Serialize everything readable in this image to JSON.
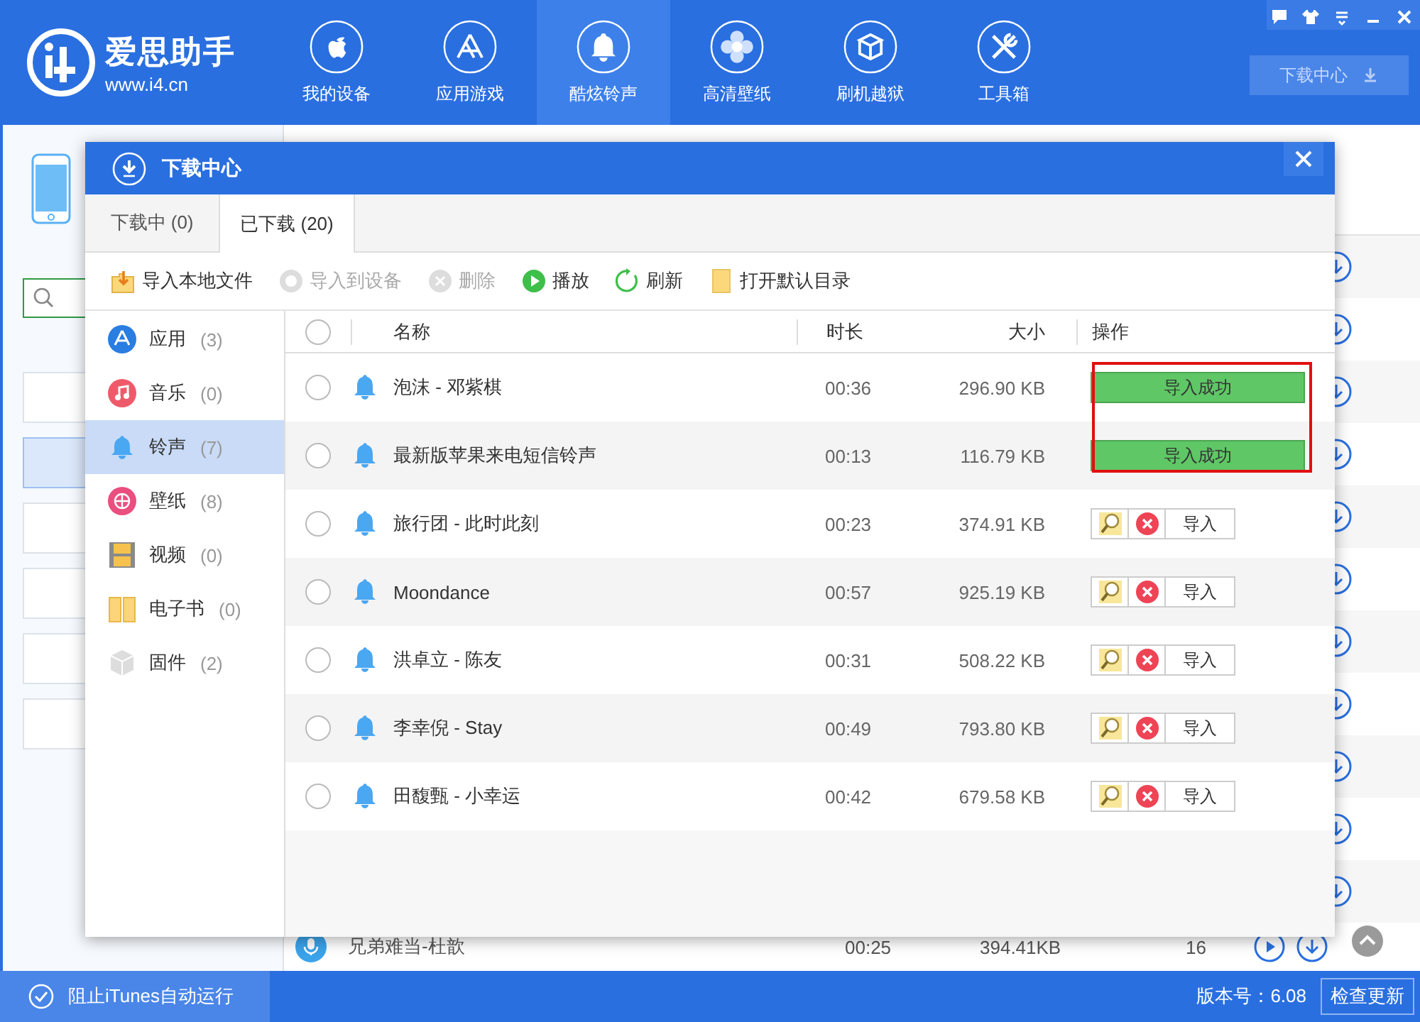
{
  "app": {
    "logo_name": "爱思助手",
    "logo_url": "www.i4.cn"
  },
  "nav": [
    {
      "label": "我的设备",
      "kind": "apple",
      "selected": false
    },
    {
      "label": "应用游戏",
      "kind": "appstore",
      "selected": false
    },
    {
      "label": "酷炫铃声",
      "kind": "bell",
      "selected": true
    },
    {
      "label": "高清壁纸",
      "kind": "flower",
      "selected": false
    },
    {
      "label": "刷机越狱",
      "kind": "box",
      "selected": false
    },
    {
      "label": "工具箱",
      "kind": "tools",
      "selected": false
    }
  ],
  "download_center_button": "下载中心",
  "background_list": [
    {
      "selected": false
    },
    {
      "selected": true
    },
    {
      "selected": false
    },
    {
      "selected": false
    },
    {
      "selected": false
    },
    {
      "selected": false
    }
  ],
  "background_row": {
    "title": "兄弟难当-杜歆",
    "duration": "00:25",
    "size": "394.41KB",
    "count": "16"
  },
  "dialog": {
    "title": "下载中心",
    "tabs": [
      {
        "label": "下载中 (0)",
        "selected": false
      },
      {
        "label": "已下载 (20)",
        "selected": true
      }
    ],
    "toolbar": [
      {
        "label": "导入本地文件",
        "kind": "import",
        "disabled": false
      },
      {
        "label": "导入到设备",
        "kind": "device",
        "disabled": true
      },
      {
        "label": "删除",
        "kind": "delete",
        "disabled": true
      },
      {
        "label": "播放",
        "kind": "play",
        "disabled": false
      },
      {
        "label": "刷新",
        "kind": "refresh",
        "disabled": false
      },
      {
        "label": "打开默认目录",
        "kind": "folder",
        "disabled": false
      }
    ],
    "categories": [
      {
        "label": "应用",
        "count": "(3)",
        "kind": "app",
        "selected": false
      },
      {
        "label": "音乐",
        "count": "(0)",
        "kind": "music",
        "selected": false
      },
      {
        "label": "铃声",
        "count": "(7)",
        "kind": "bell",
        "selected": true
      },
      {
        "label": "壁纸",
        "count": "(8)",
        "kind": "wallpaper",
        "selected": false
      },
      {
        "label": "视频",
        "count": "(0)",
        "kind": "video",
        "selected": false
      },
      {
        "label": "电子书",
        "count": "(0)",
        "kind": "book",
        "selected": false
      },
      {
        "label": "固件",
        "count": "(2)",
        "kind": "firmware",
        "selected": false
      }
    ],
    "table": {
      "columns": [
        "名称",
        "时长",
        "大小",
        "操作"
      ],
      "all_checked": false,
      "rows": [
        {
          "checked": false,
          "name": "泡沫 - 邓紫棋",
          "duration": "00:36",
          "size": "296.90 KB",
          "kind": "done",
          "action": "导入成功"
        },
        {
          "checked": false,
          "name": "最新版苹果来电短信铃声",
          "duration": "00:13",
          "size": "116.79 KB",
          "kind": "done",
          "action": "导入成功"
        },
        {
          "checked": false,
          "name": "旅行团 - 此时此刻",
          "duration": "00:23",
          "size": "374.91 KB",
          "kind": "pending",
          "action": "导入"
        },
        {
          "checked": false,
          "name": "Moondance",
          "duration": "00:57",
          "size": "925.19 KB",
          "kind": "pending",
          "action": "导入"
        },
        {
          "checked": false,
          "name": "洪卓立 - 陈友",
          "duration": "00:31",
          "size": "508.22 KB",
          "kind": "pending",
          "action": "导入"
        },
        {
          "checked": false,
          "name": "李幸倪 - Stay",
          "duration": "00:49",
          "size": "793.80 KB",
          "kind": "pending",
          "action": "导入"
        },
        {
          "checked": false,
          "name": "田馥甄 - 小幸运",
          "duration": "00:42",
          "size": "679.58 KB",
          "kind": "pending",
          "action": "导入"
        }
      ]
    }
  },
  "status_bar": {
    "itunes_block": "阻止iTunes自动运行",
    "checked": true,
    "version": "版本号：6.08",
    "update": "检查更新"
  }
}
